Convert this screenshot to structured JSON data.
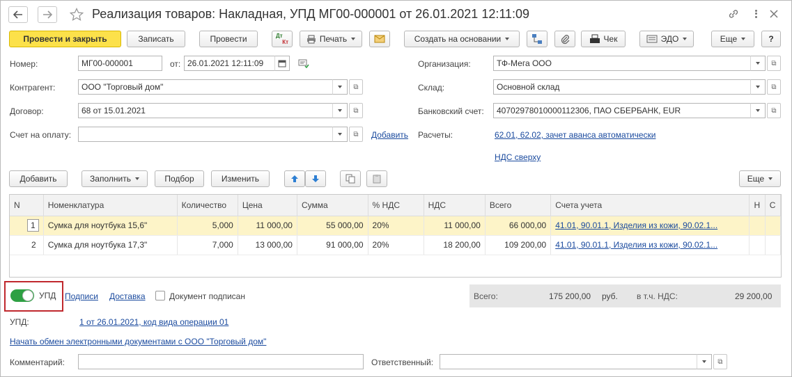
{
  "window": {
    "title": "Реализация товаров: Накладная, УПД МГ00-000001 от 26.01.2021 12:11:09"
  },
  "toolbar": {
    "post_close": "Провести и закрыть",
    "save": "Записать",
    "post": "Провести",
    "print": "Печать",
    "create_based": "Создать на основании",
    "check": "Чек",
    "edo": "ЭДО",
    "more": "Еще",
    "help": "?",
    "dtkt_top": "Дт",
    "dtkt_bottom": "Кт"
  },
  "form": {
    "number_label": "Номер:",
    "number_value": "МГ00-000001",
    "from_label": "от:",
    "date_value": "26.01.2021 12:11:09",
    "org_label": "Организация:",
    "org_value": "ТФ-Мега ООО",
    "contractor_label": "Контрагент:",
    "contractor_value": "ООО \"Торговый дом\"",
    "warehouse_label": "Склад:",
    "warehouse_value": "Основной склад",
    "contract_label": "Договор:",
    "contract_value": "68 от 15.01.2021",
    "bank_label": "Банковский счет:",
    "bank_value": "40702978010000112306, ПАО СБЕРБАНК, EUR",
    "invoice_label": "Счет на оплату:",
    "invoice_value": "",
    "add_link": "Добавить",
    "settlements_label": "Расчеты:",
    "settlements_link": "62.01, 62.02, зачет аванса автоматически",
    "vat_link": "НДС сверху"
  },
  "table_toolbar": {
    "add": "Добавить",
    "fill": "Заполнить",
    "select": "Подбор",
    "change": "Изменить",
    "more": "Еще"
  },
  "table": {
    "headers": [
      "N",
      "Номенклатура",
      "Количество",
      "Цена",
      "Сумма",
      "% НДС",
      "НДС",
      "Всего",
      "Счета учета",
      "Н",
      "С"
    ],
    "rows": [
      {
        "n": "1",
        "item": "Сумка для ноутбука 15,6\"",
        "qty": "5,000",
        "price": "11 000,00",
        "sum": "55 000,00",
        "vat_rate": "20%",
        "vat": "11 000,00",
        "total": "66 000,00",
        "accounts": "41.01, 90.01.1, Изделия из кожи, 90.02.1..."
      },
      {
        "n": "2",
        "item": "Сумка для ноутбука 17,3\"",
        "qty": "7,000",
        "price": "13 000,00",
        "sum": "91 000,00",
        "vat_rate": "20%",
        "vat": "18 200,00",
        "total": "109 200,00",
        "accounts": "41.01, 90.01.1, Изделия из кожи, 90.02.1..."
      }
    ]
  },
  "footer": {
    "upd_toggle_label": "УПД",
    "signatures_link": "Подписи",
    "delivery_link": "Доставка",
    "signed_label": "Документ подписан",
    "total_label": "Всего:",
    "total_value": "175 200,00",
    "currency": "руб.",
    "vat_label": "в т.ч. НДС:",
    "vat_value": "29 200,00",
    "upd_label": "УПД:",
    "upd_link": "1 от 26.01.2021, код вида операции 01",
    "edo_link": "Начать обмен электронными документами с ООО \"Торговый дом\"",
    "comment_label": "Комментарий:",
    "comment_value": "",
    "responsible_label": "Ответственный:",
    "responsible_value": ""
  },
  "colors": {
    "primary_button": "#fce14a",
    "link": "#1a4a9e",
    "toggle_on": "#2ea043",
    "highlight_border": "#c0282d",
    "selected_row": "#fdf4c8"
  }
}
